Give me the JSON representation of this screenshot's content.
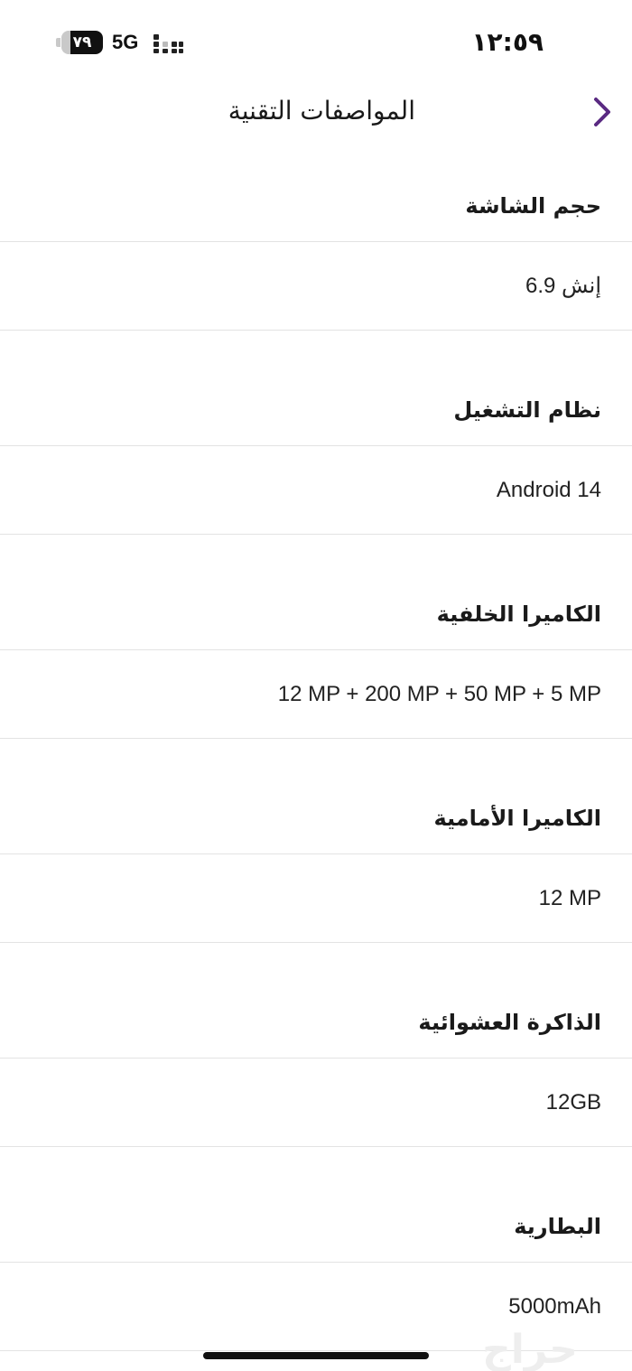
{
  "status_bar": {
    "battery_level": "٧٩",
    "battery_fraction": 0.79,
    "network": "5G",
    "time": "١٢:٥٩"
  },
  "header": {
    "title": "المواصفات التقنية",
    "back_icon": "chevron-right-icon"
  },
  "specs": [
    {
      "label": "حجم الشاشة",
      "value": "6.9 إنش"
    },
    {
      "label": "نظام التشغيل",
      "value": "Android 14"
    },
    {
      "label": "الكاميرا الخلفية",
      "value": "12 MP + 200 MP + 50 MP + 5 MP"
    },
    {
      "label": "الكاميرا الأمامية",
      "value": "12 MP"
    },
    {
      "label": "الذاكرة العشوائية",
      "value": "12GB"
    },
    {
      "label": "البطارية",
      "value": "5000mAh"
    }
  ],
  "watermark": {
    "text": "حراج"
  },
  "colors": {
    "accent": "#5a2a82",
    "divider": "#e3e3e3",
    "text": "#1a1a1a"
  }
}
